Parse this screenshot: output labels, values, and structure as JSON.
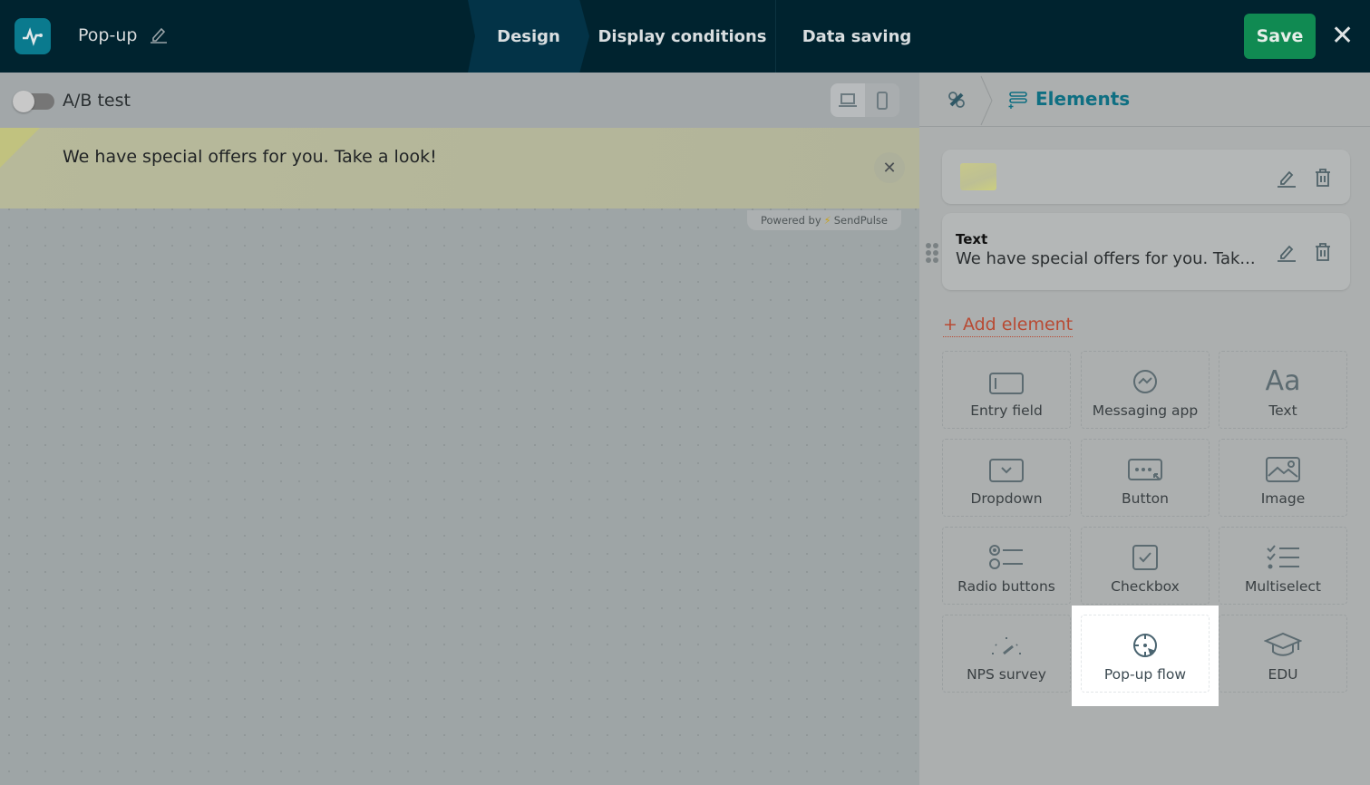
{
  "header": {
    "title": "Pop-up",
    "tabs": [
      {
        "label": "Design"
      },
      {
        "label": "Display conditions"
      },
      {
        "label": "Data saving"
      }
    ],
    "save_label": "Save",
    "close_label": "✕"
  },
  "toolbar": {
    "ab_test_label": "A/B test",
    "ab_test_enabled": false
  },
  "preview": {
    "banner_text": "We have special offers for you. Take a look!",
    "close_label": "✕",
    "powered_by": "Powered by",
    "brand": "SendPulse"
  },
  "panel": {
    "breadcrumb_current": "Elements",
    "elements": [
      {
        "type": "Image"
      },
      {
        "label": "Text",
        "preview": "We have special offers for you. Tak..."
      }
    ],
    "add_element_label": "+ Add element",
    "tiles": [
      {
        "label": "Entry field"
      },
      {
        "label": "Messaging app"
      },
      {
        "label": "Text"
      },
      {
        "label": "Dropdown"
      },
      {
        "label": "Button"
      },
      {
        "label": "Image"
      },
      {
        "label": "Radio buttons"
      },
      {
        "label": "Checkbox"
      },
      {
        "label": "Multiselect"
      },
      {
        "label": "NPS survey"
      },
      {
        "label": "Pop-up flow"
      },
      {
        "label": "EDU"
      }
    ]
  },
  "colors": {
    "header": "#00232f",
    "save": "#108a52",
    "accent": "#0f6f82",
    "add": "#b84a33"
  }
}
